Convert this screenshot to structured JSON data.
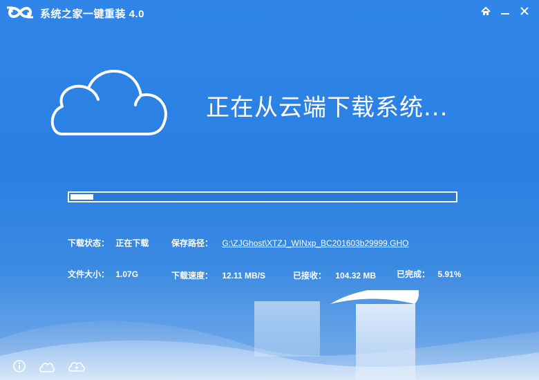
{
  "app": {
    "title": "系统之家一键重装  4.0",
    "logo_icon": "infinity-logo-icon",
    "window_buttons": [
      "home-icon",
      "minimize-icon",
      "close-icon"
    ]
  },
  "main": {
    "headline": "正在从云端下载系统...",
    "progress_percent": 5.91
  },
  "info": {
    "status_label": "下载状态：",
    "status_value": "正在下载",
    "path_label": "保存路径：",
    "path_value": "G:\\ZJGhost\\XTZJ_WINxp_BC201603b29999.GHO",
    "size_label": "文件大小：",
    "size_value": "1.07G",
    "speed_label": "下载速度：",
    "speed_value": "12.11 MB/S",
    "received_label": "已接收：",
    "received_value": "104.32 MB",
    "completed_label": "已完成：",
    "completed_value": "5.91%"
  },
  "bottom_bar": {
    "icons": [
      "info-icon",
      "cloud-icon",
      "cloud-lightning-icon"
    ]
  },
  "colors": {
    "background": "#2f86e8",
    "text": "#ffffff",
    "progress_fill": "#ffffff"
  }
}
